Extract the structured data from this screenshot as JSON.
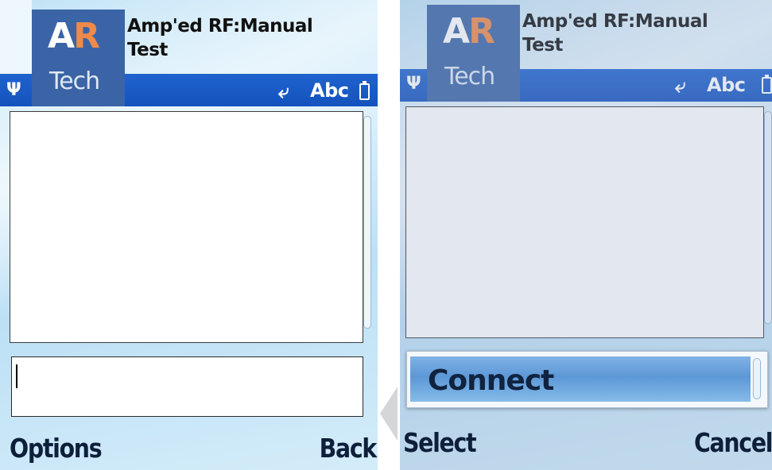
{
  "left_screen": {
    "logo": {
      "letter_a": "A",
      "letter_r": "R",
      "tech": "Tech"
    },
    "title_line1": "Amp'ed RF:Manual",
    "title_line2": "Test",
    "status": {
      "antenna": "Ψ",
      "input_mode": "Abc",
      "pen_icon": "⤶"
    },
    "input_value": "",
    "softkeys": {
      "left": "Options",
      "right": "Back"
    }
  },
  "right_screen": {
    "logo": {
      "letter_a": "A",
      "letter_r": "R",
      "tech": "Tech"
    },
    "title_line1": "Amp'ed RF:Manual",
    "title_line2": "Test",
    "status": {
      "antenna": "Ψ",
      "input_mode": "Abc",
      "pen_icon": "⤶"
    },
    "popup_menu": {
      "items": [
        "Connect"
      ]
    },
    "softkeys": {
      "left": "Select",
      "right": "Cancel"
    }
  },
  "colors": {
    "status_bar": "#1452bd",
    "logo_bg": "#3b64a6",
    "logo_r": "#ef8a4a",
    "menu_highlight": "#5d98d6"
  }
}
